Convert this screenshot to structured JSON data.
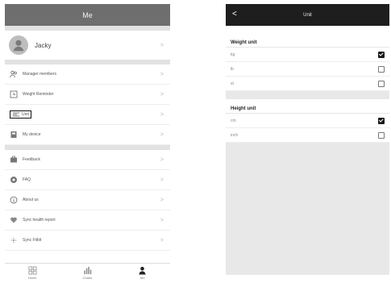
{
  "left": {
    "title": "Me",
    "profile": {
      "name": "Jacky"
    },
    "group1": [
      {
        "label": "Manager members",
        "icon": "members-icon"
      },
      {
        "label": "Weight Reminder",
        "icon": "reminder-icon"
      },
      {
        "label": "Unit",
        "icon": "unit-icon"
      },
      {
        "label": "My device",
        "icon": "device-icon"
      }
    ],
    "group2": [
      {
        "label": "Feedback",
        "icon": "feedback-icon"
      },
      {
        "label": "FAQ",
        "icon": "faq-icon"
      },
      {
        "label": "About us",
        "icon": "info-icon"
      },
      {
        "label": "Sync health report",
        "icon": "heart-icon"
      },
      {
        "label": "Sync Fitbit",
        "icon": "fitbit-icon"
      }
    ],
    "tabs": [
      {
        "label": "Home",
        "icon": "grid-icon"
      },
      {
        "label": "Charts",
        "icon": "bar-chart-icon"
      },
      {
        "label": "Me",
        "icon": "person-icon"
      }
    ]
  },
  "right": {
    "title": "Unit",
    "weight": {
      "title": "Weight unit",
      "options": [
        {
          "label": "kg",
          "checked": true
        },
        {
          "label": "lb",
          "checked": false
        },
        {
          "label": "st",
          "checked": false
        }
      ]
    },
    "height": {
      "title": "Height unit",
      "options": [
        {
          "label": "cm",
          "checked": true
        },
        {
          "label": "inch",
          "checked": false
        }
      ]
    }
  },
  "chevron": ">",
  "back_glyph": "<"
}
